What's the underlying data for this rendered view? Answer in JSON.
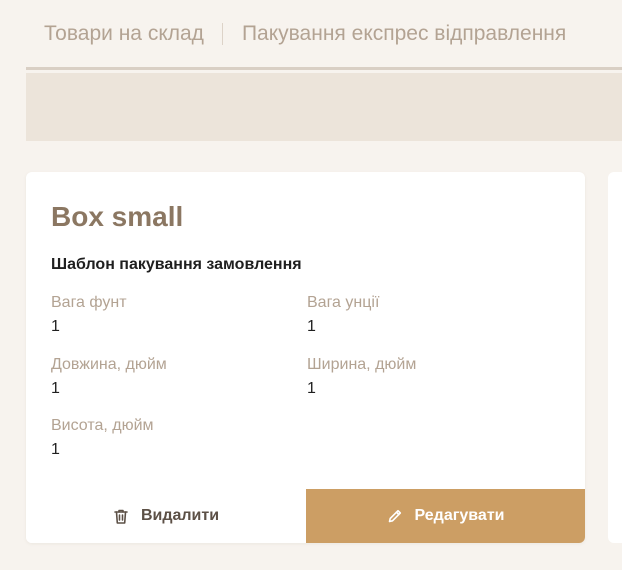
{
  "tabs": [
    {
      "label": "Товари на склад"
    },
    {
      "label": "Пакування експрес відправлення"
    }
  ],
  "card": {
    "title": "Box small",
    "subtitle": "Шаблон пакування замовлення",
    "fields": [
      {
        "label": "Вага фунт",
        "value": "1"
      },
      {
        "label": "Вага унції",
        "value": "1"
      },
      {
        "label": "Довжина, дюйм",
        "value": "1"
      },
      {
        "label": "Ширина, дюйм",
        "value": "1"
      },
      {
        "label": "Висота, дюйм",
        "value": "1"
      }
    ],
    "delete_label": "Видалити",
    "edit_label": "Редагувати",
    "icons": {
      "delete": "trash-icon",
      "edit": "pencil-icon"
    }
  },
  "colors": {
    "background": "#f7f3ee",
    "accent": "#cc9e64",
    "title": "#8b7762",
    "muted_label": "#b3a393"
  }
}
